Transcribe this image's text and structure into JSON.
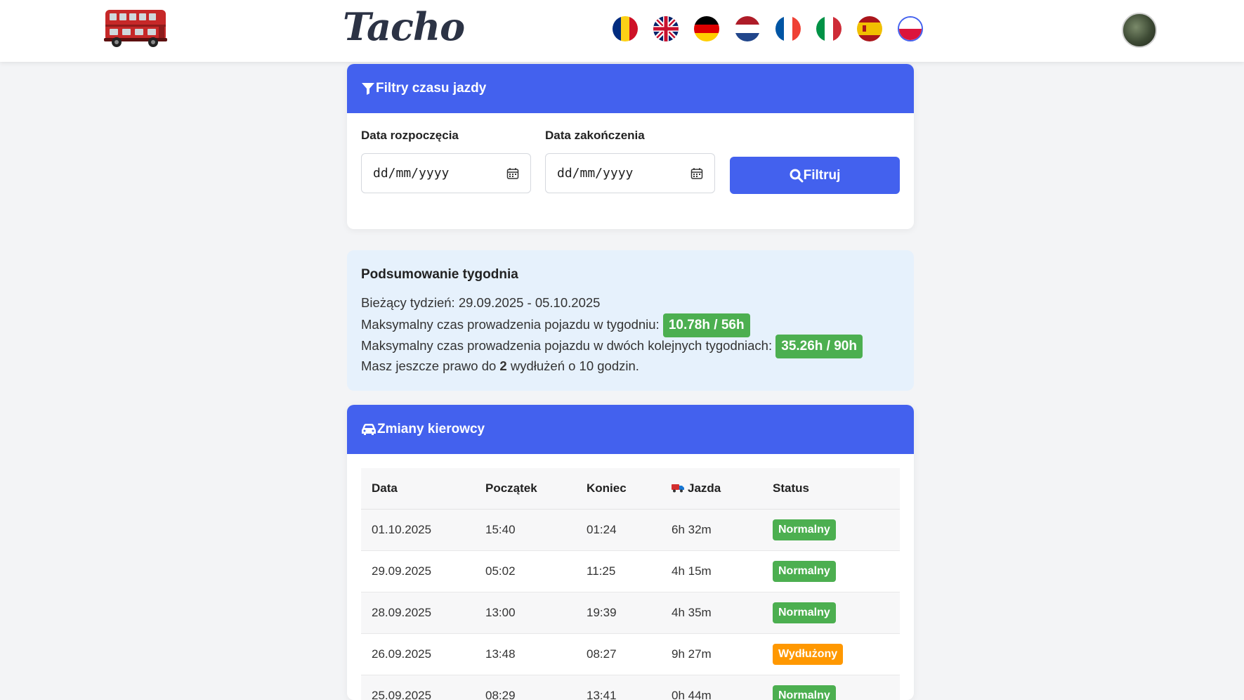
{
  "nav": {
    "brand": "Tacho",
    "flags": [
      {
        "name": "flag-ro-icon",
        "country": "Romania"
      },
      {
        "name": "flag-gb-icon",
        "country": "United Kingdom"
      },
      {
        "name": "flag-de-icon",
        "country": "Germany"
      },
      {
        "name": "flag-nl-icon",
        "country": "Netherlands"
      },
      {
        "name": "flag-fr-icon",
        "country": "France"
      },
      {
        "name": "flag-it-icon",
        "country": "Italy"
      },
      {
        "name": "flag-es-icon",
        "country": "Spain"
      },
      {
        "name": "flag-pl-icon",
        "country": "Poland",
        "active": true
      }
    ]
  },
  "filters": {
    "title": "Filtry czasu jazdy",
    "start_label": "Data rozpoczęcia",
    "end_label": "Data zakończenia",
    "start_value": "dd/mm/yyyy",
    "end_value": "dd/mm/yyyy",
    "button_label": "Filtruj"
  },
  "summary": {
    "title": "Podsumowanie tygodnia",
    "current_week": "Bieżący tydzień: 29.09.2025 - 05.10.2025",
    "weekly_label": "Maksymalny czas prowadzenia pojazdu w tygodniu:",
    "weekly_value": "10.78h / 56h",
    "biweekly_label": "Maksymalny czas prowadzenia pojazdu w dwóch kolejnych tygodniach:",
    "biweekly_value": "35.26h / 90h",
    "extensions_prefix": "Masz jeszcze prawo do",
    "extensions_count": "2",
    "extensions_suffix": "wydłużeń o 10 godzin."
  },
  "shifts": {
    "title": "Zmiany kierowcy",
    "columns": [
      "Data",
      "Początek",
      "Koniec",
      "Jazda",
      "Status"
    ],
    "rows": [
      {
        "date": "01.10.2025",
        "start": "15:40",
        "end": "01:24",
        "driving": "6h 32m",
        "status": "Normalny"
      },
      {
        "date": "29.09.2025",
        "start": "05:02",
        "end": "11:25",
        "driving": "4h 15m",
        "status": "Normalny"
      },
      {
        "date": "28.09.2025",
        "start": "13:00",
        "end": "19:39",
        "driving": "4h 35m",
        "status": "Normalny"
      },
      {
        "date": "26.09.2025",
        "start": "13:48",
        "end": "08:27",
        "driving": "9h 27m",
        "status": "Wydłużony"
      },
      {
        "date": "25.09.2025",
        "start": "08:29",
        "end": "13:41",
        "driving": "0h 44m",
        "status": "Normalny"
      }
    ]
  },
  "colors": {
    "accent": "#4361ee",
    "normal": "#4caf50",
    "extended": "#ff9800",
    "summary_bg": "#e6f1fc"
  }
}
